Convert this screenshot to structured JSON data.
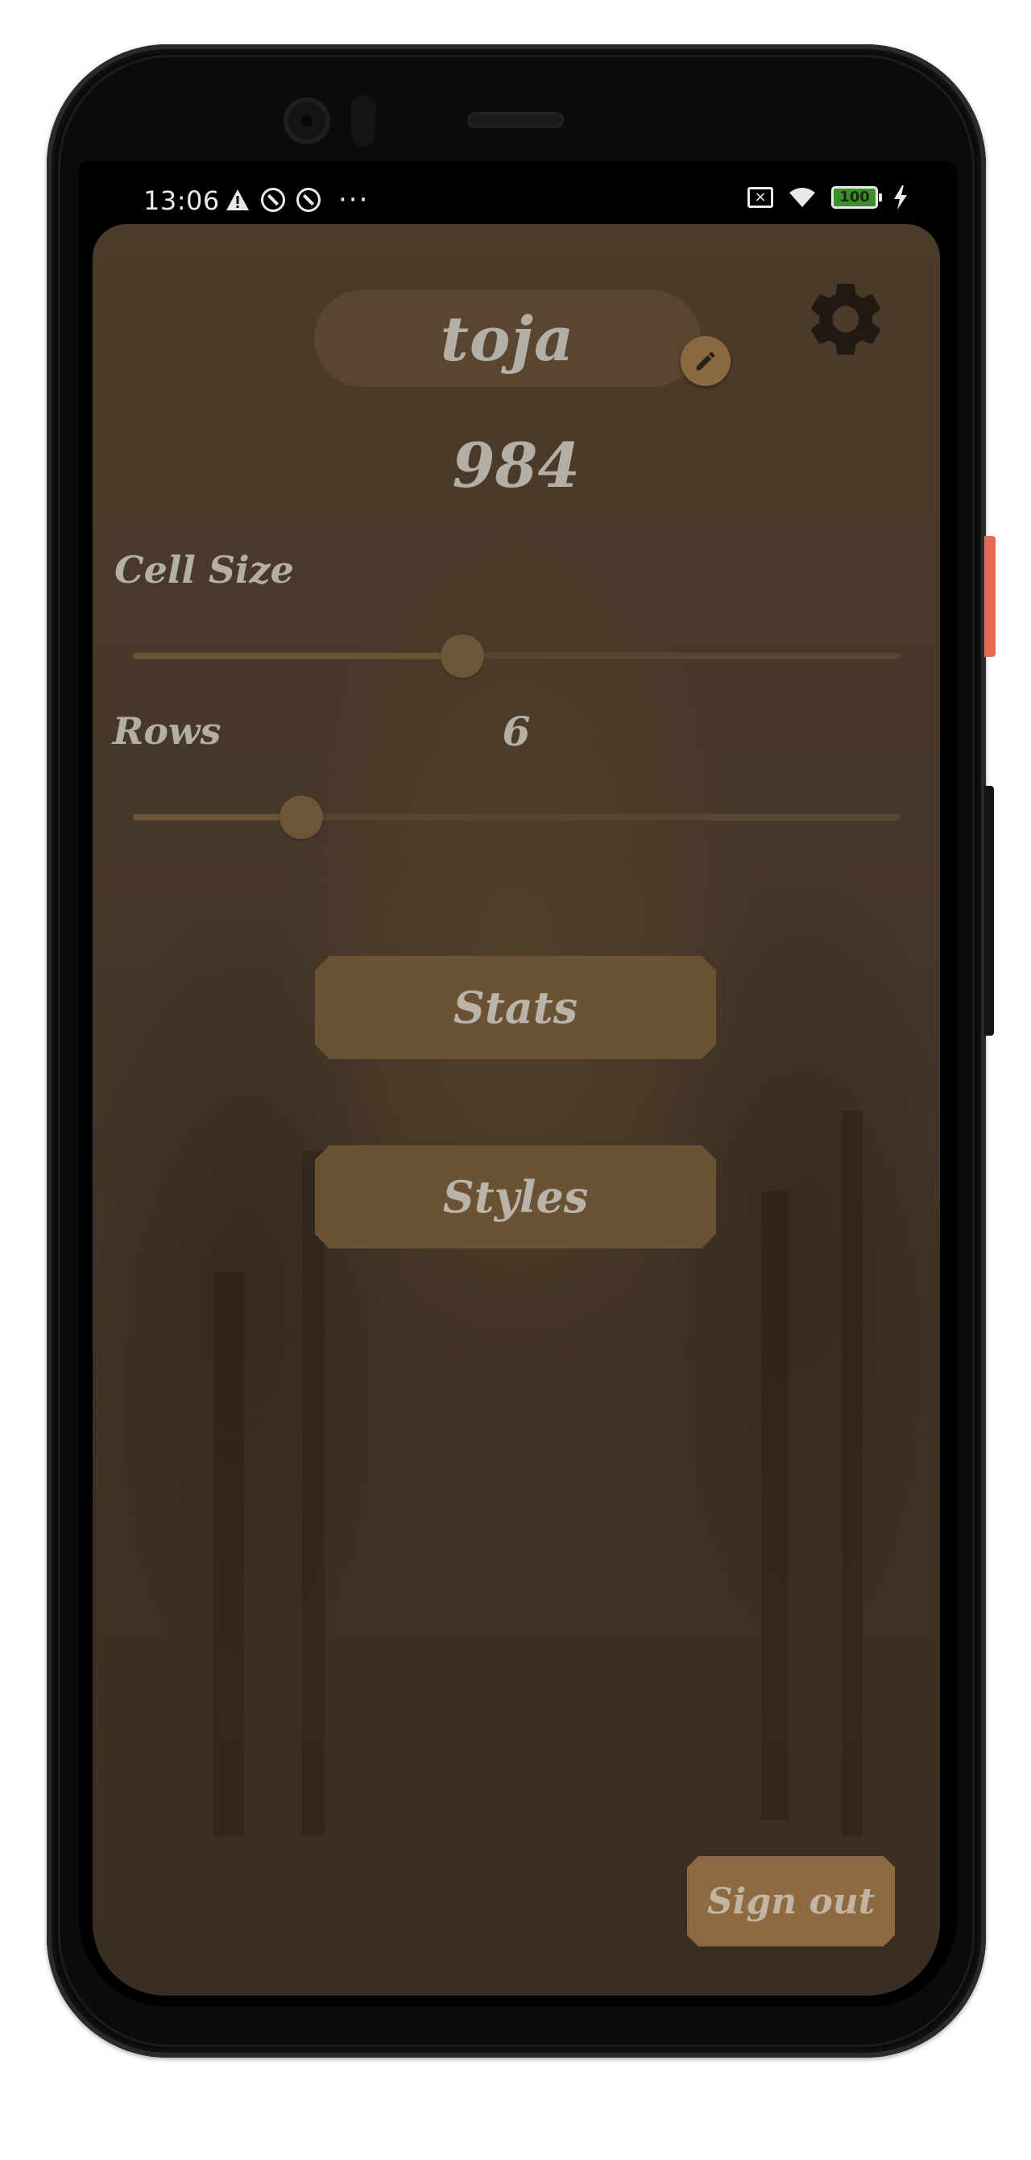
{
  "status_bar": {
    "time": "13:06",
    "left_icons": [
      "warning-icon",
      "do-not-disturb-icon",
      "do-not-disturb-icon",
      "more-dots-icon"
    ],
    "more_glyph": "···",
    "battery_level": "100",
    "right_icons": [
      "no-sim-icon",
      "wifi-icon",
      "battery-icon",
      "charging-icon"
    ]
  },
  "profile": {
    "username": "toja",
    "score": "984"
  },
  "settings": {
    "cell_size_label": "Cell Size",
    "cell_size_fraction": 0.43,
    "rows_label": "Rows",
    "rows_value": "6",
    "rows_fraction": 0.22
  },
  "menu": {
    "stats_label": "Stats",
    "styles_label": "Styles",
    "sign_out_label": "Sign out"
  },
  "colors": {
    "background": "#45372a",
    "button": "#6b5234",
    "sign_out_button": "#8e6a42",
    "text": "#b3aea6",
    "edit_fab": "#8a6840",
    "gear": "#1f1912"
  }
}
